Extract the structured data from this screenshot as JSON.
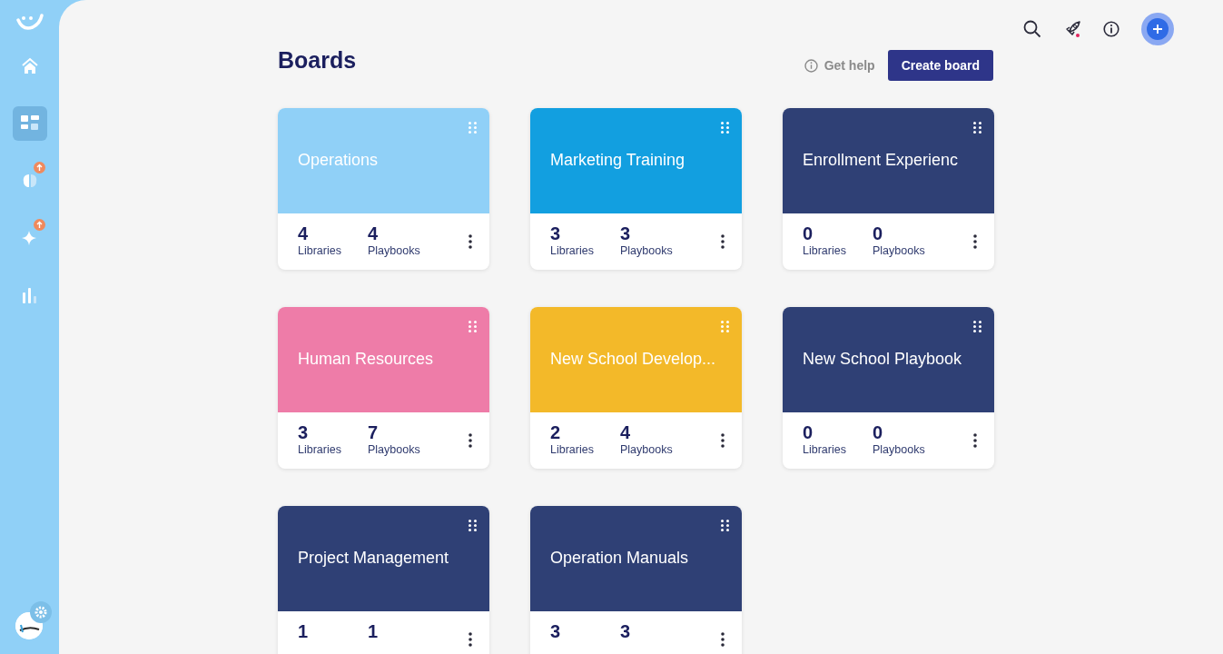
{
  "sidebar": {
    "items": [
      {
        "kind": "home",
        "selected": false,
        "badge": false
      },
      {
        "kind": "boards",
        "selected": true,
        "badge": false
      },
      {
        "kind": "ideas",
        "selected": false,
        "badge": true
      },
      {
        "kind": "sparkle",
        "selected": false,
        "badge": true
      },
      {
        "kind": "chart",
        "selected": false,
        "badge": false
      }
    ]
  },
  "page": {
    "title": "Boards",
    "help_link": "Get help",
    "create_button": "Create board"
  },
  "boards": [
    {
      "title": "Operations",
      "color": "#90d0f7",
      "libraries": "4",
      "libraries_label": "Libraries",
      "playbooks": "4",
      "playbooks_label": "Playbooks"
    },
    {
      "title": "Marketing Training",
      "color": "#129fe0",
      "libraries": "3",
      "libraries_label": "Libraries",
      "playbooks": "3",
      "playbooks_label": "Playbooks"
    },
    {
      "title": "Enrollment Experienc",
      "color": "#2f4075",
      "libraries": "0",
      "libraries_label": "Libraries",
      "playbooks": "0",
      "playbooks_label": "Playbooks"
    },
    {
      "title": "Human Resources",
      "color": "#ee7ca8",
      "libraries": "3",
      "libraries_label": "Libraries",
      "playbooks": "7",
      "playbooks_label": "Playbooks"
    },
    {
      "title": "New School Develop...",
      "color": "#f3b929",
      "libraries": "2",
      "libraries_label": "Libraries",
      "playbooks": "4",
      "playbooks_label": "Playbooks"
    },
    {
      "title": "New School Playbook",
      "color": "#2f4075",
      "libraries": "0",
      "libraries_label": "Libraries",
      "playbooks": "0",
      "playbooks_label": "Playbooks"
    },
    {
      "title": "Project Management",
      "color": "#2f4075",
      "libraries": "1",
      "playbooks": "1"
    },
    {
      "title": "Operation Manuals",
      "color": "#2f4075",
      "libraries": "3",
      "playbooks": "3"
    }
  ]
}
